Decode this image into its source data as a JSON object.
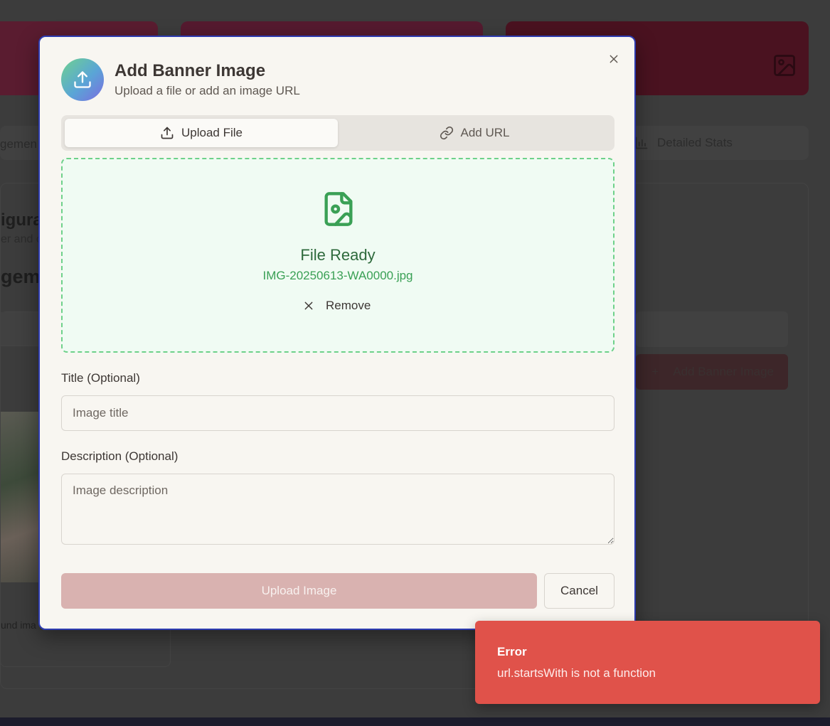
{
  "background": {
    "tab_left_partial": "gemen",
    "tab_stats_label": "Detailed Stats",
    "panel_title_partial": "igura",
    "panel_subtitle_partial": "er and c",
    "panel_heading_partial": "gem",
    "card_caption_partial": "und ima",
    "add_button_label": "Add Banner Image"
  },
  "modal": {
    "title": "Add Banner Image",
    "subtitle": "Upload a file or add an image URL",
    "tabs": [
      {
        "label": "Upload File",
        "active": true
      },
      {
        "label": "Add URL",
        "active": false
      }
    ],
    "dropzone": {
      "status": "File Ready",
      "filename": "IMG-20250613-WA0000.jpg",
      "remove_label": "Remove"
    },
    "title_field": {
      "label": "Title (Optional)",
      "placeholder": "Image title",
      "value": ""
    },
    "description_field": {
      "label": "Description (Optional)",
      "placeholder": "Image description",
      "value": ""
    },
    "upload_label": "Upload Image",
    "cancel_label": "Cancel"
  },
  "toast": {
    "title": "Error",
    "message": "url.startsWith is not a function"
  },
  "colors": {
    "accent_blue_border": "#2d3bb0",
    "success_green": "#3aa055",
    "upload_disabled": "#d9b2b0",
    "error_red": "#e0524a"
  },
  "icons": {
    "header": "upload-icon",
    "tab_upload": "upload-icon",
    "tab_url": "link-icon",
    "file": "file-image-icon",
    "remove": "x-icon",
    "close": "close-icon"
  }
}
